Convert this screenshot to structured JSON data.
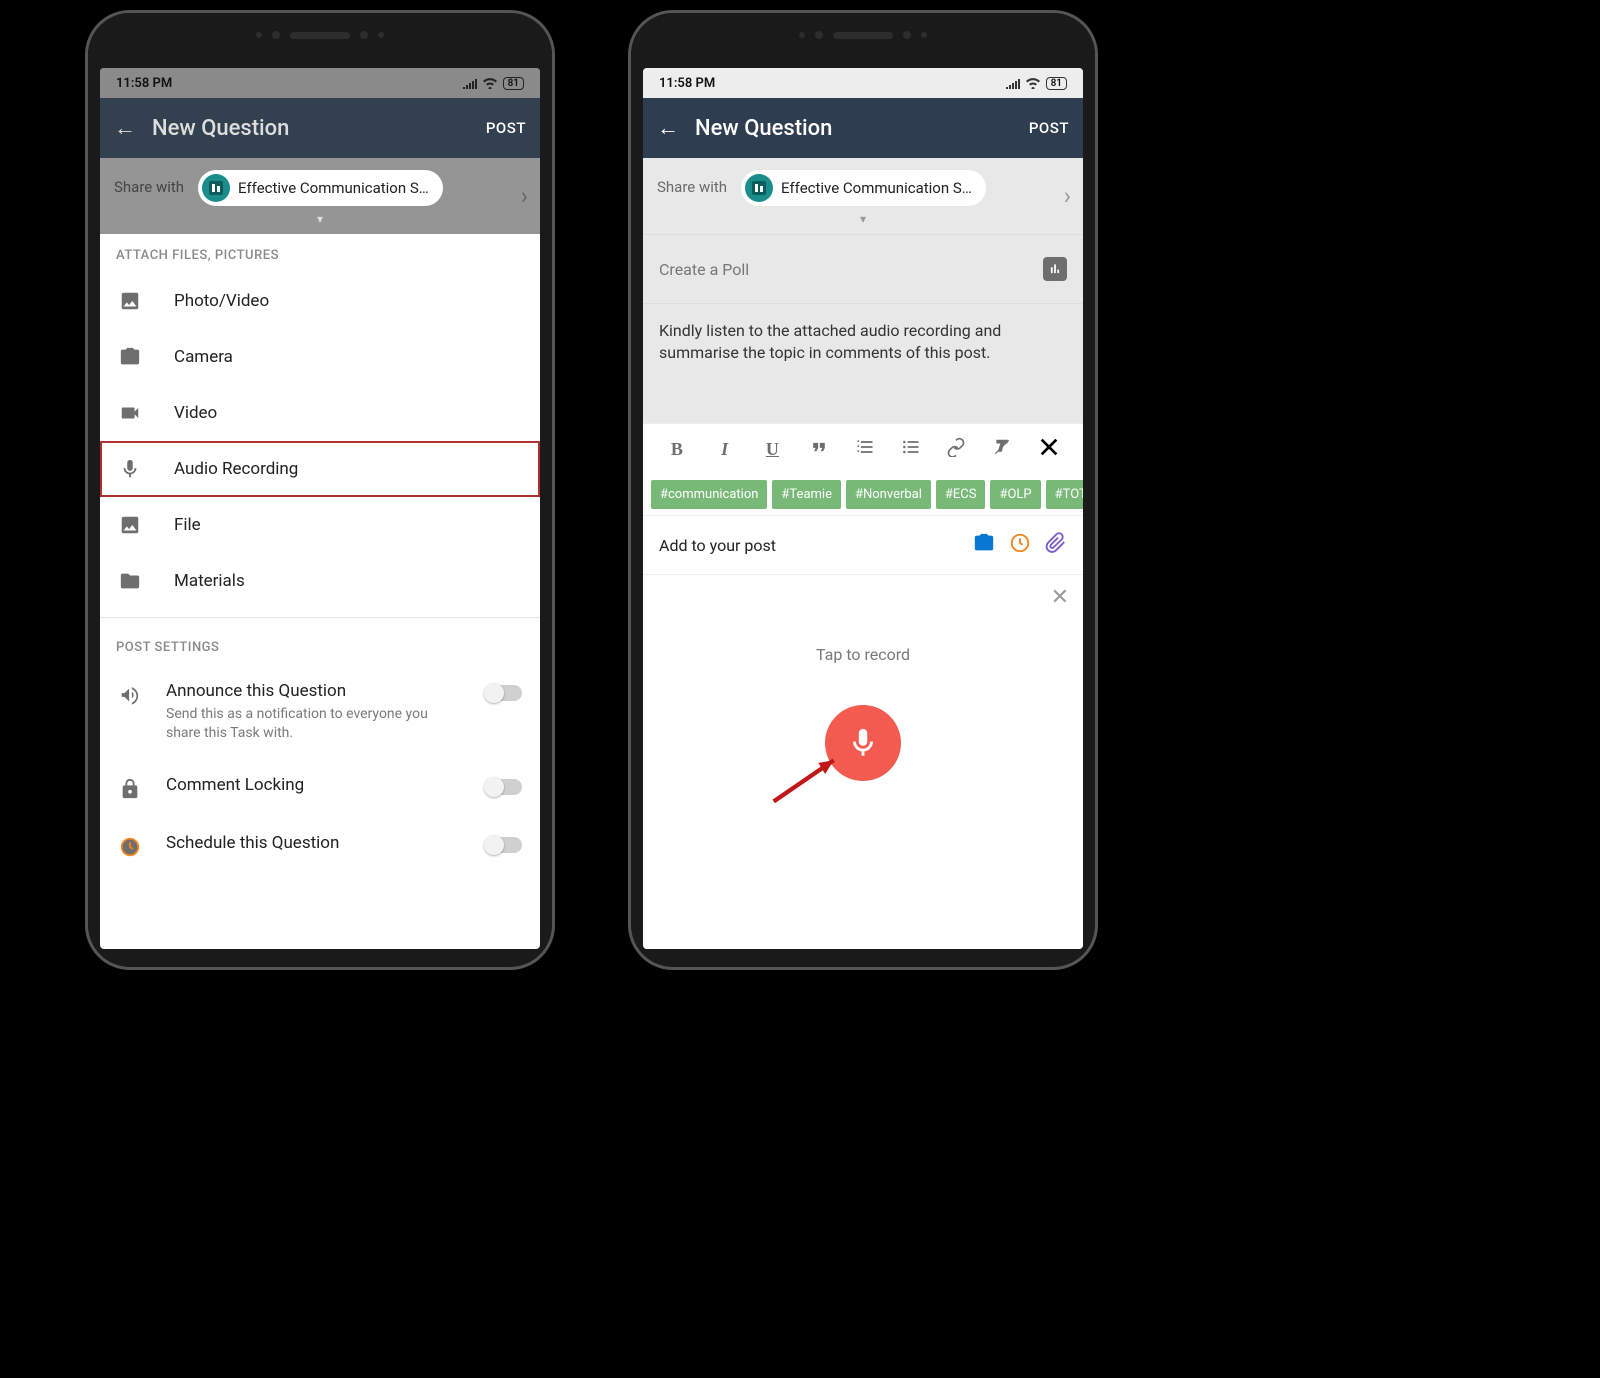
{
  "status": {
    "time": "11:58 PM",
    "battery": "81"
  },
  "appbar": {
    "title": "New Question",
    "post": "POST"
  },
  "share": {
    "label": "Share with",
    "chip": "Effective Communication S…"
  },
  "attach": {
    "header": "ATTACH FILES, PICTURES",
    "items": {
      "photo": "Photo/Video",
      "camera": "Camera",
      "video": "Video",
      "audio": "Audio Recording",
      "file": "File",
      "materials": "Materials"
    }
  },
  "settings": {
    "header": "POST SETTINGS",
    "announce": {
      "title": "Announce this Question",
      "desc": "Send this as a notification to everyone you share this Task with."
    },
    "locking": "Comment Locking",
    "schedule": "Schedule this Question"
  },
  "poll": {
    "label": "Create a Poll"
  },
  "body": "Kindly listen to the attached audio recording and summarise the topic in comments of this post.",
  "tags": [
    "#communication",
    "#Teamie",
    "#Nonverbal",
    "#ECS",
    "#OLP",
    "#TOTD"
  ],
  "addLabel": "Add to your post",
  "record": {
    "hint": "Tap to record"
  }
}
